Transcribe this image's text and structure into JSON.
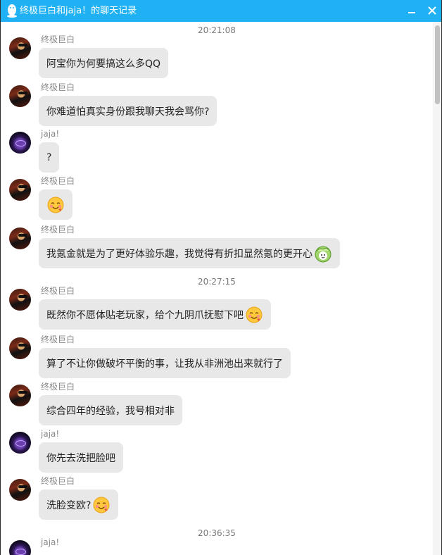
{
  "window": {
    "title": "终极巨白和jaja！的聊天记录"
  },
  "timestamps": [
    "20:21:08",
    "20:27:15",
    "20:36:35"
  ],
  "messages": [
    {
      "sender": "终极巨白",
      "text": "阿宝你为何要搞这么多QQ"
    },
    {
      "sender": "终极巨白",
      "text": "你难道怕真实身份跟我聊天我会骂你?"
    },
    {
      "sender": "jaja!",
      "text": "?"
    },
    {
      "sender": "终极巨白",
      "text": "",
      "emoji": "smiling-face-emoji"
    },
    {
      "sender": "终极巨白",
      "text": "我氪金就是为了更好体验乐趣，我觉得有折扣显然氪的更开心",
      "emoji": "cabbage-face-emoji"
    },
    {
      "sender": "终极巨白",
      "text": "既然你不愿体贴老玩家，给个九阴爪抚慰下吧",
      "emoji": "smiling-face-emoji"
    },
    {
      "sender": "终极巨白",
      "text": "算了不让你做破坏平衡的事，让我从非洲池出来就行了"
    },
    {
      "sender": "终极巨白",
      "text": "综合四年的经验，我号相对非"
    },
    {
      "sender": "jaja!",
      "text": "你先去洗把脸吧"
    },
    {
      "sender": "终极巨白",
      "text": "洗脸变欧?",
      "emoji": "smiling-face-emoji"
    },
    {
      "sender": "jaja!",
      "text": ""
    }
  ],
  "colors": {
    "titlebar": "#1fb1f3",
    "bubble": "#e8e8e8"
  }
}
